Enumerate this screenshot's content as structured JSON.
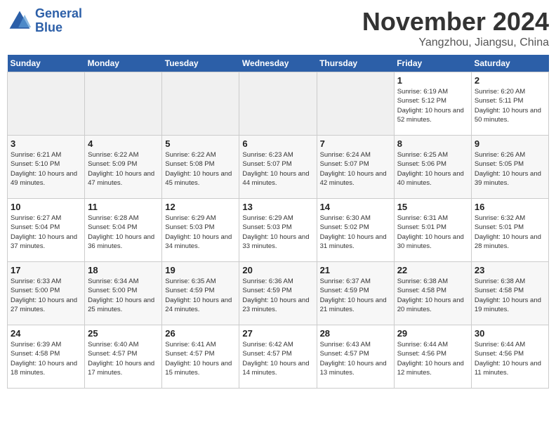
{
  "logo": {
    "line1": "General",
    "line2": "Blue"
  },
  "title": "November 2024",
  "location": "Yangzhou, Jiangsu, China",
  "weekdays": [
    "Sunday",
    "Monday",
    "Tuesday",
    "Wednesday",
    "Thursday",
    "Friday",
    "Saturday"
  ],
  "weeks": [
    [
      {
        "day": "",
        "info": ""
      },
      {
        "day": "",
        "info": ""
      },
      {
        "day": "",
        "info": ""
      },
      {
        "day": "",
        "info": ""
      },
      {
        "day": "",
        "info": ""
      },
      {
        "day": "1",
        "info": "Sunrise: 6:19 AM\nSunset: 5:12 PM\nDaylight: 10 hours\nand 52 minutes."
      },
      {
        "day": "2",
        "info": "Sunrise: 6:20 AM\nSunset: 5:11 PM\nDaylight: 10 hours\nand 50 minutes."
      }
    ],
    [
      {
        "day": "3",
        "info": "Sunrise: 6:21 AM\nSunset: 5:10 PM\nDaylight: 10 hours\nand 49 minutes."
      },
      {
        "day": "4",
        "info": "Sunrise: 6:22 AM\nSunset: 5:09 PM\nDaylight: 10 hours\nand 47 minutes."
      },
      {
        "day": "5",
        "info": "Sunrise: 6:22 AM\nSunset: 5:08 PM\nDaylight: 10 hours\nand 45 minutes."
      },
      {
        "day": "6",
        "info": "Sunrise: 6:23 AM\nSunset: 5:07 PM\nDaylight: 10 hours\nand 44 minutes."
      },
      {
        "day": "7",
        "info": "Sunrise: 6:24 AM\nSunset: 5:07 PM\nDaylight: 10 hours\nand 42 minutes."
      },
      {
        "day": "8",
        "info": "Sunrise: 6:25 AM\nSunset: 5:06 PM\nDaylight: 10 hours\nand 40 minutes."
      },
      {
        "day": "9",
        "info": "Sunrise: 6:26 AM\nSunset: 5:05 PM\nDaylight: 10 hours\nand 39 minutes."
      }
    ],
    [
      {
        "day": "10",
        "info": "Sunrise: 6:27 AM\nSunset: 5:04 PM\nDaylight: 10 hours\nand 37 minutes."
      },
      {
        "day": "11",
        "info": "Sunrise: 6:28 AM\nSunset: 5:04 PM\nDaylight: 10 hours\nand 36 minutes."
      },
      {
        "day": "12",
        "info": "Sunrise: 6:29 AM\nSunset: 5:03 PM\nDaylight: 10 hours\nand 34 minutes."
      },
      {
        "day": "13",
        "info": "Sunrise: 6:29 AM\nSunset: 5:03 PM\nDaylight: 10 hours\nand 33 minutes."
      },
      {
        "day": "14",
        "info": "Sunrise: 6:30 AM\nSunset: 5:02 PM\nDaylight: 10 hours\nand 31 minutes."
      },
      {
        "day": "15",
        "info": "Sunrise: 6:31 AM\nSunset: 5:01 PM\nDaylight: 10 hours\nand 30 minutes."
      },
      {
        "day": "16",
        "info": "Sunrise: 6:32 AM\nSunset: 5:01 PM\nDaylight: 10 hours\nand 28 minutes."
      }
    ],
    [
      {
        "day": "17",
        "info": "Sunrise: 6:33 AM\nSunset: 5:00 PM\nDaylight: 10 hours\nand 27 minutes."
      },
      {
        "day": "18",
        "info": "Sunrise: 6:34 AM\nSunset: 5:00 PM\nDaylight: 10 hours\nand 25 minutes."
      },
      {
        "day": "19",
        "info": "Sunrise: 6:35 AM\nSunset: 4:59 PM\nDaylight: 10 hours\nand 24 minutes."
      },
      {
        "day": "20",
        "info": "Sunrise: 6:36 AM\nSunset: 4:59 PM\nDaylight: 10 hours\nand 23 minutes."
      },
      {
        "day": "21",
        "info": "Sunrise: 6:37 AM\nSunset: 4:59 PM\nDaylight: 10 hours\nand 21 minutes."
      },
      {
        "day": "22",
        "info": "Sunrise: 6:38 AM\nSunset: 4:58 PM\nDaylight: 10 hours\nand 20 minutes."
      },
      {
        "day": "23",
        "info": "Sunrise: 6:38 AM\nSunset: 4:58 PM\nDaylight: 10 hours\nand 19 minutes."
      }
    ],
    [
      {
        "day": "24",
        "info": "Sunrise: 6:39 AM\nSunset: 4:58 PM\nDaylight: 10 hours\nand 18 minutes."
      },
      {
        "day": "25",
        "info": "Sunrise: 6:40 AM\nSunset: 4:57 PM\nDaylight: 10 hours\nand 17 minutes."
      },
      {
        "day": "26",
        "info": "Sunrise: 6:41 AM\nSunset: 4:57 PM\nDaylight: 10 hours\nand 15 minutes."
      },
      {
        "day": "27",
        "info": "Sunrise: 6:42 AM\nSunset: 4:57 PM\nDaylight: 10 hours\nand 14 minutes."
      },
      {
        "day": "28",
        "info": "Sunrise: 6:43 AM\nSunset: 4:57 PM\nDaylight: 10 hours\nand 13 minutes."
      },
      {
        "day": "29",
        "info": "Sunrise: 6:44 AM\nSunset: 4:56 PM\nDaylight: 10 hours\nand 12 minutes."
      },
      {
        "day": "30",
        "info": "Sunrise: 6:44 AM\nSunset: 4:56 PM\nDaylight: 10 hours\nand 11 minutes."
      }
    ]
  ]
}
